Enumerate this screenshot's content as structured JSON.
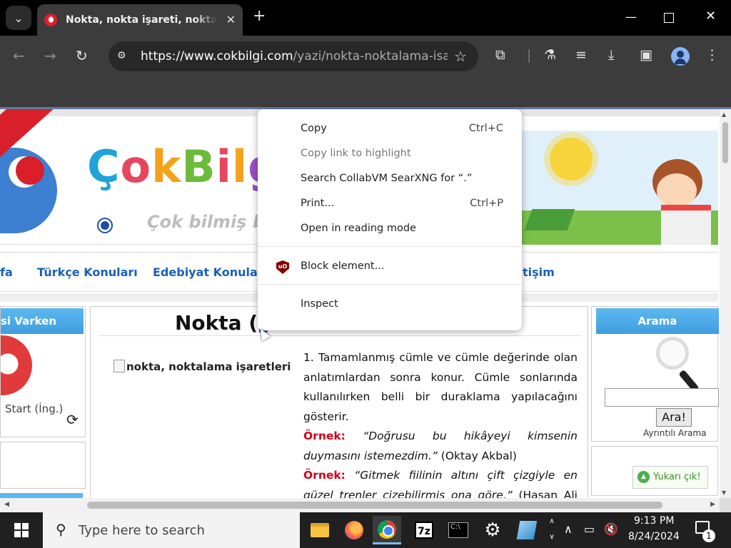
{
  "browser": {
    "tab_title": "Nokta, nokta işareti, noktanın k",
    "url_host": "https://www.cokbilgi.com",
    "url_path": "/yazi/nokta-noktalama-isare..."
  },
  "site": {
    "logo": "ÇokBilgi",
    "tagline": "Çok bilmiş bir",
    "nav": [
      "fa",
      "Türkçe Konuları",
      "Edebiyat Konuları",
      "tişim"
    ]
  },
  "left_sidebar": {
    "header": "si Varken",
    "start_text": "Start (İng.)"
  },
  "article": {
    "title": "Nokta (",
    "image_alt": "nokta, noktalama işaretleri",
    "para1": "1. Tamamlanmış cümle ve cümle değerinde olan anlatımlardan sonra konur. Cümle sonlarında kullanılırken belli bir duraklama yapılacağını gösterir.",
    "ex1_label": "Örnek:",
    "ex1_quote": "“Doğrusu bu hikâyeyi kimsenin duymasını istemezdim.”",
    "ex1_source": "(Oktay Akbal)",
    "ex2_label": "Örnek:",
    "ex2_quote": "“Gitmek fiilinin altını çift çizgiyle en güzel trenler çizebilirmiş ona göre.”",
    "ex2_source": "(Hasan Ali Toptaş)"
  },
  "right_sidebar": {
    "header": "Arama",
    "search_button": "Ara!",
    "advanced_search": "Ayrıntılı Arama",
    "back_to_top": "Yukarı çık!"
  },
  "context_menu": {
    "items": [
      {
        "label": "Copy",
        "shortcut": "Ctrl+C"
      },
      {
        "label": "Copy link to highlight",
        "shortcut": ""
      },
      {
        "label": "Search CollabVM SearXNG for “.”",
        "shortcut": ""
      },
      {
        "label": "Print...",
        "shortcut": "Ctrl+P"
      },
      {
        "label": "Open in reading mode",
        "shortcut": ""
      },
      {
        "label": "Block element...",
        "shortcut": ""
      },
      {
        "label": "Inspect",
        "shortcut": ""
      }
    ]
  },
  "taskbar": {
    "search_placeholder": "Type here to search",
    "time": "9:13 PM",
    "date": "8/24/2024",
    "notification_count": "1",
    "sevenzip_label": "7z"
  }
}
